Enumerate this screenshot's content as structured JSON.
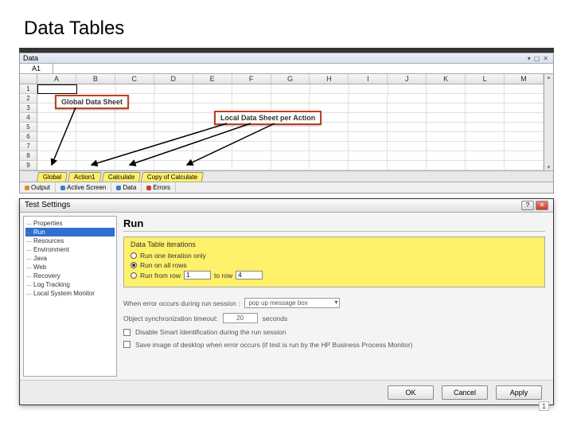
{
  "title": "Data Tables",
  "data_panel": {
    "title": "Data",
    "cell_ref": "A1",
    "columns": [
      "A",
      "B",
      "C",
      "D",
      "E",
      "F",
      "G",
      "H",
      "I",
      "J",
      "K",
      "L",
      "M"
    ],
    "rows": [
      "1",
      "2",
      "3",
      "4",
      "5",
      "6",
      "7",
      "8",
      "9"
    ],
    "sheet_tabs": [
      "Global",
      "Action1",
      "Calculate",
      "Copy of Calculate"
    ],
    "pane_tabs": [
      {
        "label": "Output",
        "color": "#d98c2e"
      },
      {
        "label": "Active Screen",
        "color": "#3a7cc8"
      },
      {
        "label": "Data",
        "color": "#3a7cc8"
      },
      {
        "label": "Errors",
        "color": "#cc3a3a"
      }
    ],
    "callout_global": "Global Data Sheet",
    "callout_local": "Local Data Sheet per Action"
  },
  "dialog": {
    "title": "Test Settings",
    "tree": [
      "Properties",
      "Run",
      "Resources",
      "Environment",
      "Java",
      "Web",
      "Recovery",
      "Log Tracking",
      "Local System Monitor"
    ],
    "selected_tree": "Run",
    "heading": "Run",
    "iterations": {
      "group_title": "Data Table iterations",
      "opt1": "Run one iteration only",
      "opt2": "Run on all rows",
      "opt3_a": "Run from row",
      "opt3_b": "to row",
      "from_val": "1",
      "to_val": "4"
    },
    "error_label": "When error occurs during run session :",
    "error_value": "pop up message box",
    "sync_label": "Object synchronization timeout:",
    "sync_value": "20",
    "sync_unit": "seconds",
    "chk1": "Disable Smart Identification during the run session",
    "chk2": "Save image of desktop when error occurs (if test is run by the HP Business Process Monitor)",
    "buttons": {
      "ok": "OK",
      "cancel": "Cancel",
      "apply": "Apply"
    }
  },
  "pagenum": "1"
}
